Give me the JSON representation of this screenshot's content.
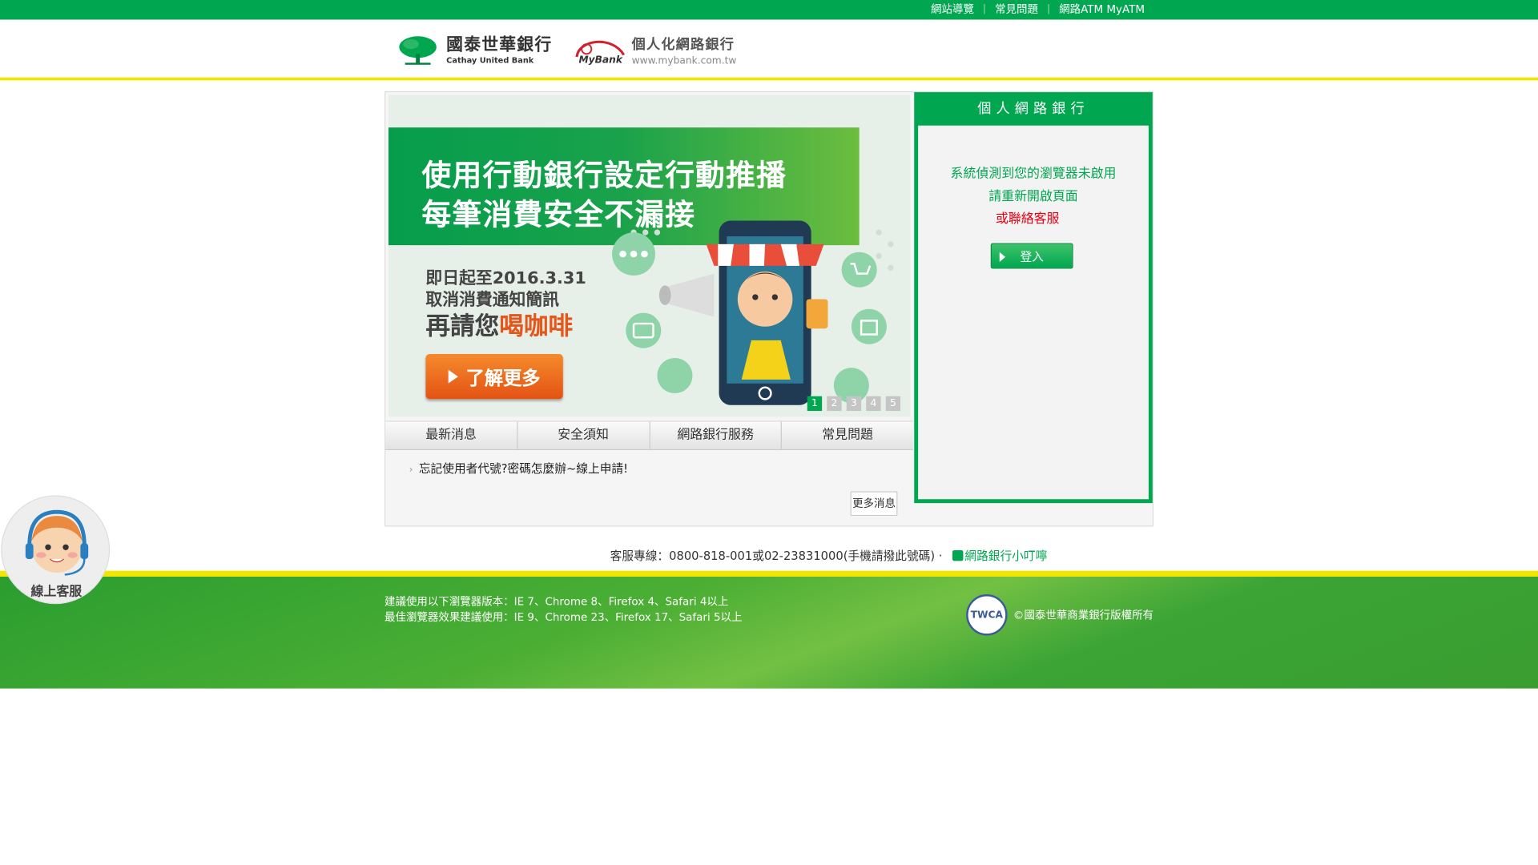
{
  "top_links": [
    "網站導覽",
    "常見問題",
    "網路ATM MyATM"
  ],
  "header": {
    "bank_name_cn": "國泰世華銀行",
    "bank_name_en": "Cathay United Bank",
    "product_cn": "個人化網路銀行",
    "product_brand": "MyBank",
    "product_url": "www.mybank.com.tw"
  },
  "banner": {
    "headline_1": "使用行動銀行設定行動推播",
    "headline_2": "每筆消費安全不漏接",
    "promo_1": "即日起至2016.3.31",
    "promo_2": "取消消費通知簡訊",
    "promo_3a": "再請您",
    "promo_3b": "喝咖啡",
    "more_button": "了解更多",
    "slides": [
      "1",
      "2",
      "3",
      "4",
      "5"
    ],
    "active_slide": "1"
  },
  "tabs": [
    "最新消息",
    "安全須知",
    "網路銀行服務",
    "常見問題"
  ],
  "news": {
    "item": "忘記使用者代號?密碼怎麼辦~線上申請!",
    "more_button": "更多消息"
  },
  "login": {
    "title": "個人網路銀行",
    "message_1": "系統偵測到您的瀏覽器未啟用",
    "message_2": "請重新開啟頁面",
    "warning": "或聯絡客服",
    "button": "登入"
  },
  "contact": {
    "prefix": "客服專線：",
    "phone_1": "0800-818-001",
    "sep": "或",
    "phone_2": "02-23831000",
    "note": "(手機請撥此號碼)",
    "dot": "‧",
    "tip_link": "網路銀行小叮嚀"
  },
  "footer": {
    "line_1": "建議使用以下瀏覽器版本：IE 7、Chrome 8、Firefox 4、Safari 4以上",
    "line_2": "最佳瀏覽器效果建議使用：IE 9、Chrome 23、Firefox 17、Safari 5以上",
    "twca_label": "TWCA",
    "copyright": "©國泰世華商業銀行版權所有"
  },
  "customer_service": {
    "label": "線上客服"
  },
  "colors": {
    "brand_green": "#00a650",
    "accent_yellow": "#f2e600",
    "promo_orange": "#e4571a",
    "warning_red": "#e60012"
  }
}
